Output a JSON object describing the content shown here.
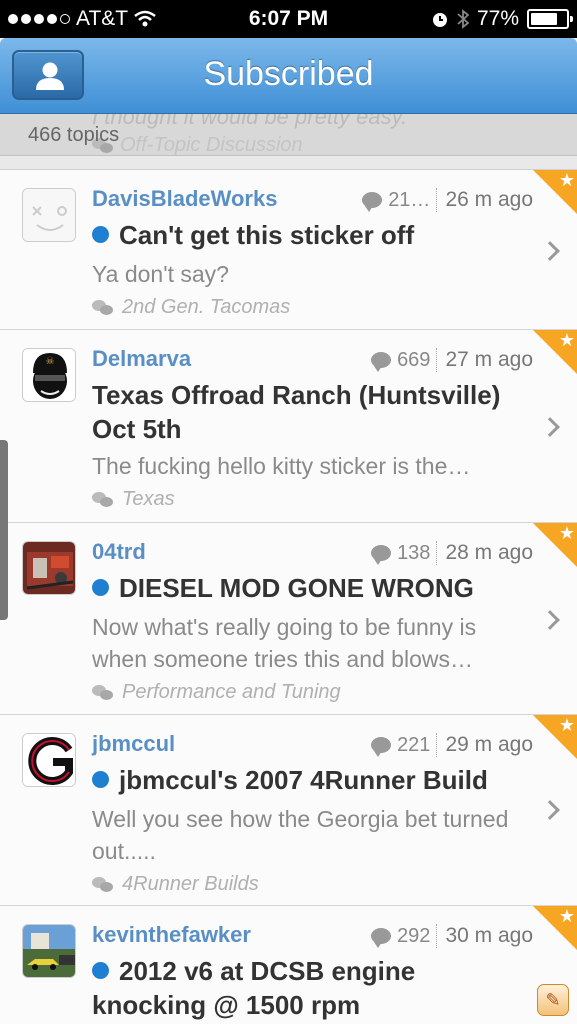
{
  "status_bar": {
    "carrier": "AT&T",
    "time": "6:07 PM",
    "battery": "77%",
    "battery_level": 0.77
  },
  "navbar": {
    "title": "Subscribed",
    "profile_icon": "user-icon"
  },
  "pull_strip": {
    "topics_count": "466 topics",
    "ghost_snippet": "I thought it would be pretty easy.",
    "ghost_forum": "Off-Topic Discussion"
  },
  "topics": [
    {
      "user": "DavisBladeWorks",
      "replies": "21…",
      "ago": "26 m ago",
      "unread": true,
      "title": "Can't get this sticker off",
      "snippet": "Ya don't say?",
      "forum": "2nd Gen. Tacomas",
      "avatar": "default-face-avatar"
    },
    {
      "user": "Delmarva",
      "replies": "669",
      "ago": "27 m ago",
      "unread": false,
      "title": "Texas Offroad Ranch (Huntsville) Oct 5th",
      "snippet": "The fucking hello kitty sticker is the…",
      "forum": "Texas",
      "avatar": "masked-face-avatar"
    },
    {
      "user": "04trd",
      "replies": "138",
      "ago": "28 m ago",
      "unread": true,
      "title": "DIESEL MOD GONE WRONG",
      "snippet": "Now what's really going to be funny is when someone tries this and blows…",
      "forum": "Performance and Tuning",
      "avatar": "engine-photo-avatar"
    },
    {
      "user": "jbmccul",
      "replies": "221",
      "ago": "29 m ago",
      "unread": true,
      "title": "jbmccul's 2007 4Runner Build",
      "snippet": "Well you see how the Georgia bet turned out.....",
      "forum": "4Runner Builds",
      "avatar": "georgia-g-avatar"
    },
    {
      "user": "kevinthefawker",
      "replies": "292",
      "ago": "30 m ago",
      "unread": true,
      "title": "2012 v6 at DCSB engine knocking @ 1500 rpm",
      "snippet": "",
      "forum": "",
      "avatar": "car-photo-avatar"
    }
  ],
  "colors": {
    "accent_blue": "#3f8fd6",
    "username": "#5a8fc6",
    "unread_dot": "#1f7fd0",
    "subscribed_corner": "#f6a623"
  }
}
